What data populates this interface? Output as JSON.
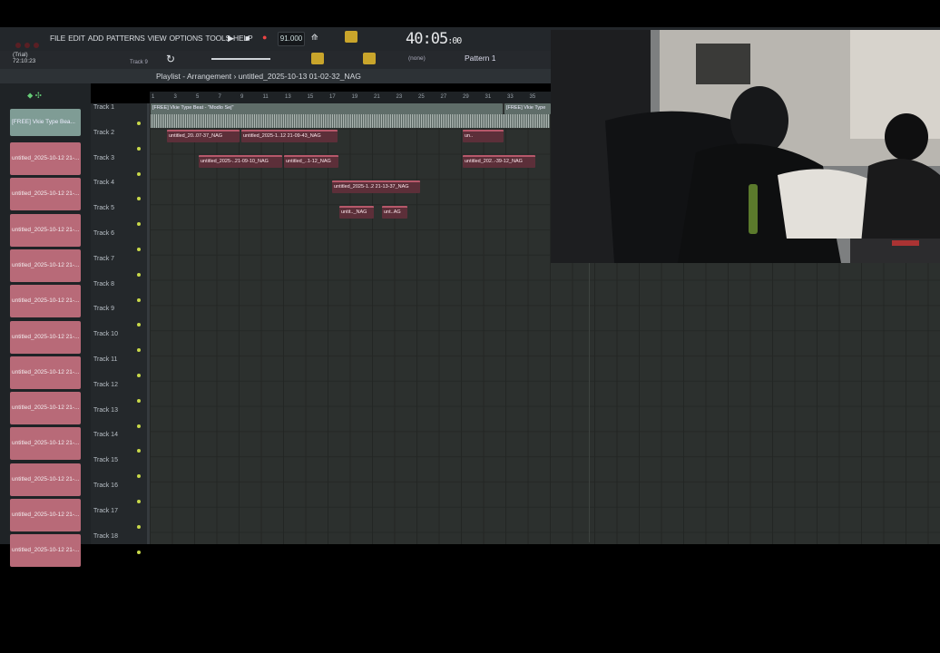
{
  "menu": [
    "FILE",
    "EDIT",
    "ADD",
    "PATTERNS",
    "VIEW",
    "OPTIONS",
    "TOOLS",
    "HELP"
  ],
  "trial": {
    "line1": "(Trial)",
    "line2": "72:10:23"
  },
  "transport": {
    "tempo": "91.000",
    "time_main": "40:05",
    "time_sub": ":00"
  },
  "toolbar": {
    "current_track": "Track 9",
    "pattern_selector": "(none)",
    "pattern": "Pattern 1"
  },
  "playlist": {
    "breadcrumb": "Playlist - Arrangement › untitled_2025-10-13 01-02-32_NAG",
    "ruler": [
      "1",
      "3",
      "5",
      "7",
      "9",
      "11",
      "13",
      "15",
      "17",
      "19",
      "21",
      "23",
      "25",
      "27",
      "29",
      "31",
      "33",
      "35"
    ],
    "tracks": [
      "Track 1",
      "Track 2",
      "Track 3",
      "Track 4",
      "Track 5",
      "Track 6",
      "Track 7",
      "Track 8",
      "Track 9",
      "Track 10",
      "Track 11",
      "Track 12",
      "Track 13",
      "Track 14",
      "Track 15",
      "Track 16",
      "Track 17",
      "Track 18"
    ],
    "clip_list": [
      "[FREE] Vkie Type Bea...",
      "untitled_2025-10-12 21-...",
      "untitled_2025-10-12 21-...",
      "untitled_2025-10-12 21-...",
      "untitled_2025-10-12 21-...",
      "untitled_2025-10-12 21-...",
      "untitled_2025-10-12 21-...",
      "untitled_2025-10-12 21-...",
      "untitled_2025-10-12 21-...",
      "untitled_2025-10-12 21-...",
      "untitled_2025-10-12 21-...",
      "untitled_2025-10-12 21-...",
      "untitled_2025-10-12 21-..."
    ],
    "arrangement": {
      "top_clip": "[FREE] Vkie Type Beat - \"Modlo Sej\"",
      "top_clip_2": "[FREE] Vkie Type",
      "t2a": "untitled_20..07-37_NAG",
      "t2b": "untitled_2025-1..12 21-09-43_NAG",
      "t2c": "un..",
      "t3a": "untitled_2025-..21-09-10_NAG",
      "t3b": "untitled_..1-12_NAG",
      "t3c": "untitled_202..-39-12_NAG",
      "t4a": "untitled_2025-1..2 21-13-37_NAG",
      "t5a": "untit.._NAG",
      "t5b": "unt..AG"
    }
  }
}
